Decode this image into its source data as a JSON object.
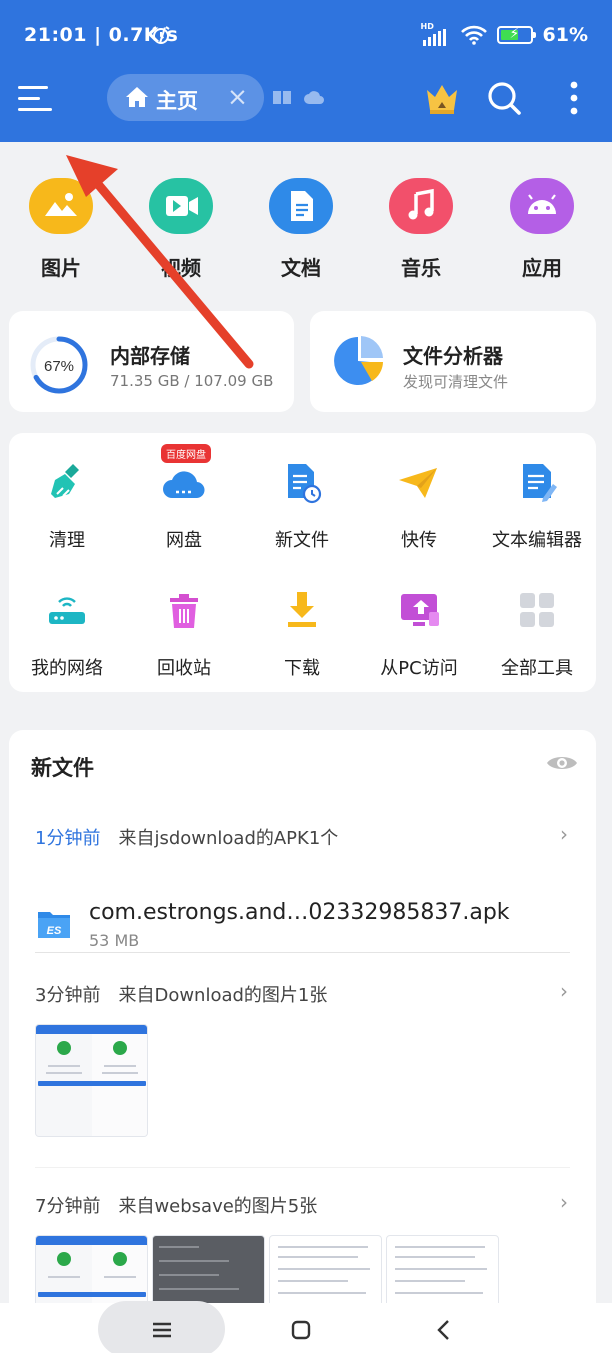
{
  "status_bar": {
    "time_speed": "21:01 | 0.7K/s",
    "network_type": "HD",
    "battery_percent": "61%",
    "battery_level": 0.61
  },
  "header": {
    "tab_label": "主页",
    "icons": [
      "menu-icon",
      "home-icon",
      "close-icon",
      "book-icon",
      "cloud-icon",
      "crown-icon",
      "search-icon",
      "more-icon"
    ]
  },
  "categories": [
    {
      "label": "图片",
      "icon": "image-icon",
      "color": "#f7b81b"
    },
    {
      "label": "视频",
      "icon": "video-icon",
      "color": "#27c2a3"
    },
    {
      "label": "文档",
      "icon": "document-icon",
      "color": "#2f8ae8"
    },
    {
      "label": "音乐",
      "icon": "music-icon",
      "color": "#f2506b"
    },
    {
      "label": "应用",
      "icon": "android-icon",
      "color": "#b45fe6"
    }
  ],
  "storage": {
    "percent_label": "67%",
    "percent": 67,
    "title": "内部存储",
    "usage": "71.35 GB / 107.09 GB"
  },
  "analyzer": {
    "title": "文件分析器",
    "subtitle": "发现可清理文件"
  },
  "tools": {
    "badge": "百度网盘",
    "items": [
      {
        "label": "清理",
        "icon": "broom-icon"
      },
      {
        "label": "网盘",
        "icon": "cloud-drive-icon"
      },
      {
        "label": "新文件",
        "icon": "new-file-icon"
      },
      {
        "label": "快传",
        "icon": "paper-plane-icon"
      },
      {
        "label": "文本编辑器",
        "icon": "text-editor-icon"
      },
      {
        "label": "我的网络",
        "icon": "router-icon"
      },
      {
        "label": "回收站",
        "icon": "trash-icon"
      },
      {
        "label": "下载",
        "icon": "download-icon"
      },
      {
        "label": "从PC访问",
        "icon": "pc-access-icon"
      },
      {
        "label": "全部工具",
        "icon": "grid-icon"
      }
    ]
  },
  "new_files": {
    "heading": "新文件",
    "groups": [
      {
        "ago": "1分钟前",
        "source": "来自jsdownload的APK1个",
        "file_name": "com.estrongs.and…02332985837.apk",
        "file_size": "53 MB"
      },
      {
        "ago": "3分钟前",
        "source": "来自Download的图片1张"
      },
      {
        "ago": "7分钟前",
        "source": "来自websave的图片5张"
      }
    ]
  },
  "colors": {
    "primary": "#2f74de",
    "annotation_arrow": "#e5402a"
  }
}
